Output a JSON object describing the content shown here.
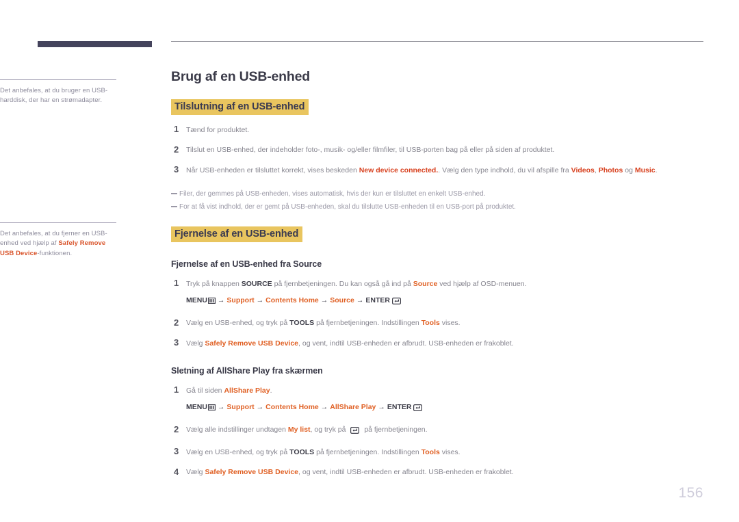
{
  "document": {
    "page_number": "156",
    "title": "Brug af en USB-enhed"
  },
  "colors": {
    "brand_bar": "#44435c",
    "section_highlight": "#e9c55f",
    "accent_orange": "#e06024",
    "accent_red": "#d8411f",
    "body_text": "#86858f",
    "page_number": "#cfcddb"
  },
  "sidebar": {
    "notes": [
      {
        "id": "note-usb-harddisk",
        "text_before": "Det anbefales, at du bruger en USB-harddisk, der har en strømadapter.",
        "highlight": "",
        "text_after": ""
      },
      {
        "id": "note-safely-remove",
        "text_before": "Det anbefales, at du fjerner en USB-enhed ved hjælp af ",
        "highlight": "Safely Remove USB Device",
        "text_after": "-funktionen."
      }
    ]
  },
  "main": {
    "sections": [
      {
        "id": "tilslutning",
        "heading": "Tilslutning af en USB-enhed",
        "steps": [
          {
            "num": "1",
            "segments": [
              {
                "t": "Tænd for produktet.",
                "style": "plain"
              }
            ]
          },
          {
            "num": "2",
            "segments": [
              {
                "t": "Tilslut en USB-enhed, der indeholder foto-, musik- og/eller filmfiler, til USB-porten bag på eller på siden af produktet.",
                "style": "plain"
              }
            ]
          },
          {
            "num": "3",
            "segments": [
              {
                "t": "Når USB-enheden er tilsluttet korrekt, vises beskeden ",
                "style": "plain"
              },
              {
                "t": "New device connected.",
                "style": "red"
              },
              {
                "t": ". Vælg den type indhold, du vil afspille fra ",
                "style": "plain"
              },
              {
                "t": "Videos",
                "style": "red"
              },
              {
                "t": ", ",
                "style": "plain"
              },
              {
                "t": "Photos",
                "style": "red"
              },
              {
                "t": " og ",
                "style": "plain"
              },
              {
                "t": "Music",
                "style": "red"
              },
              {
                "t": ".",
                "style": "plain"
              }
            ]
          }
        ],
        "notes": [
          "Filer, der gemmes på USB-enheden, vises automatisk, hvis der kun er tilsluttet en enkelt USB-enhed.",
          "For at få vist indhold, der er gemt på USB-enheden, skal du tilslutte USB-enheden til en USB-port på produktet."
        ]
      },
      {
        "id": "fjernelse",
        "heading": "Fjernelse af en USB-enhed",
        "subsections": [
          {
            "id": "fjernelse-fra-source",
            "heading": "Fjernelse af en USB-enhed fra Source",
            "steps": [
              {
                "num": "1",
                "segments": [
                  {
                    "t": "Tryk på knappen ",
                    "style": "plain"
                  },
                  {
                    "t": "SOURCE",
                    "style": "bold"
                  },
                  {
                    "t": " på fjernbetjeningen. Du kan også gå ind på ",
                    "style": "plain"
                  },
                  {
                    "t": "Source",
                    "style": "orange"
                  },
                  {
                    "t": " ved hjælp af OSD-menuen.",
                    "style": "plain"
                  }
                ],
                "menu_path": {
                  "start_label": "MENU",
                  "start_icon": "menu-icon",
                  "items": [
                    "Support",
                    "Contents Home",
                    "Source"
                  ],
                  "end_label": "ENTER",
                  "end_icon": "enter-icon",
                  "arrow": "→"
                }
              },
              {
                "num": "2",
                "segments": [
                  {
                    "t": "Vælg en USB-enhed, og tryk på ",
                    "style": "plain"
                  },
                  {
                    "t": "TOOLS",
                    "style": "bold"
                  },
                  {
                    "t": " på fjernbetjeningen. Indstillingen ",
                    "style": "plain"
                  },
                  {
                    "t": "Tools",
                    "style": "orange"
                  },
                  {
                    "t": " vises.",
                    "style": "plain"
                  }
                ]
              },
              {
                "num": "3",
                "segments": [
                  {
                    "t": "Vælg ",
                    "style": "plain"
                  },
                  {
                    "t": "Safely Remove USB Device",
                    "style": "orange"
                  },
                  {
                    "t": ", og vent, indtil USB-enheden er afbrudt. USB-enheden er frakoblet.",
                    "style": "plain"
                  }
                ]
              }
            ]
          },
          {
            "id": "sletning-allshare",
            "heading": "Sletning af AllShare Play fra skærmen",
            "steps": [
              {
                "num": "1",
                "segments": [
                  {
                    "t": "Gå til siden ",
                    "style": "plain"
                  },
                  {
                    "t": "AllShare Play",
                    "style": "orange"
                  },
                  {
                    "t": ".",
                    "style": "plain"
                  }
                ],
                "menu_path": {
                  "start_label": "MENU",
                  "start_icon": "menu-icon",
                  "items": [
                    "Support",
                    "Contents Home",
                    "AllShare Play"
                  ],
                  "end_label": "ENTER",
                  "end_icon": "enter-icon",
                  "arrow": "→"
                }
              },
              {
                "num": "2",
                "segments": [
                  {
                    "t": "Vælg alle indstillinger undtagen ",
                    "style": "plain"
                  },
                  {
                    "t": "My list",
                    "style": "orange"
                  },
                  {
                    "t": ", og tryk på ",
                    "style": "plain"
                  },
                  {
                    "t": "",
                    "style": "enter-icon"
                  },
                  {
                    "t": " på fjernbetjeningen.",
                    "style": "plain"
                  }
                ]
              },
              {
                "num": "3",
                "segments": [
                  {
                    "t": "Vælg en USB-enhed, og tryk på ",
                    "style": "plain"
                  },
                  {
                    "t": "TOOLS",
                    "style": "bold"
                  },
                  {
                    "t": " på fjernbetjeningen. Indstillingen ",
                    "style": "plain"
                  },
                  {
                    "t": "Tools",
                    "style": "orange"
                  },
                  {
                    "t": " vises.",
                    "style": "plain"
                  }
                ]
              },
              {
                "num": "4",
                "segments": [
                  {
                    "t": "Vælg ",
                    "style": "plain"
                  },
                  {
                    "t": "Safely Remove USB Device",
                    "style": "orange"
                  },
                  {
                    "t": ", og vent, indtil USB-enheden er afbrudt. USB-enheden er frakoblet.",
                    "style": "plain"
                  }
                ]
              }
            ]
          }
        ]
      }
    ]
  }
}
